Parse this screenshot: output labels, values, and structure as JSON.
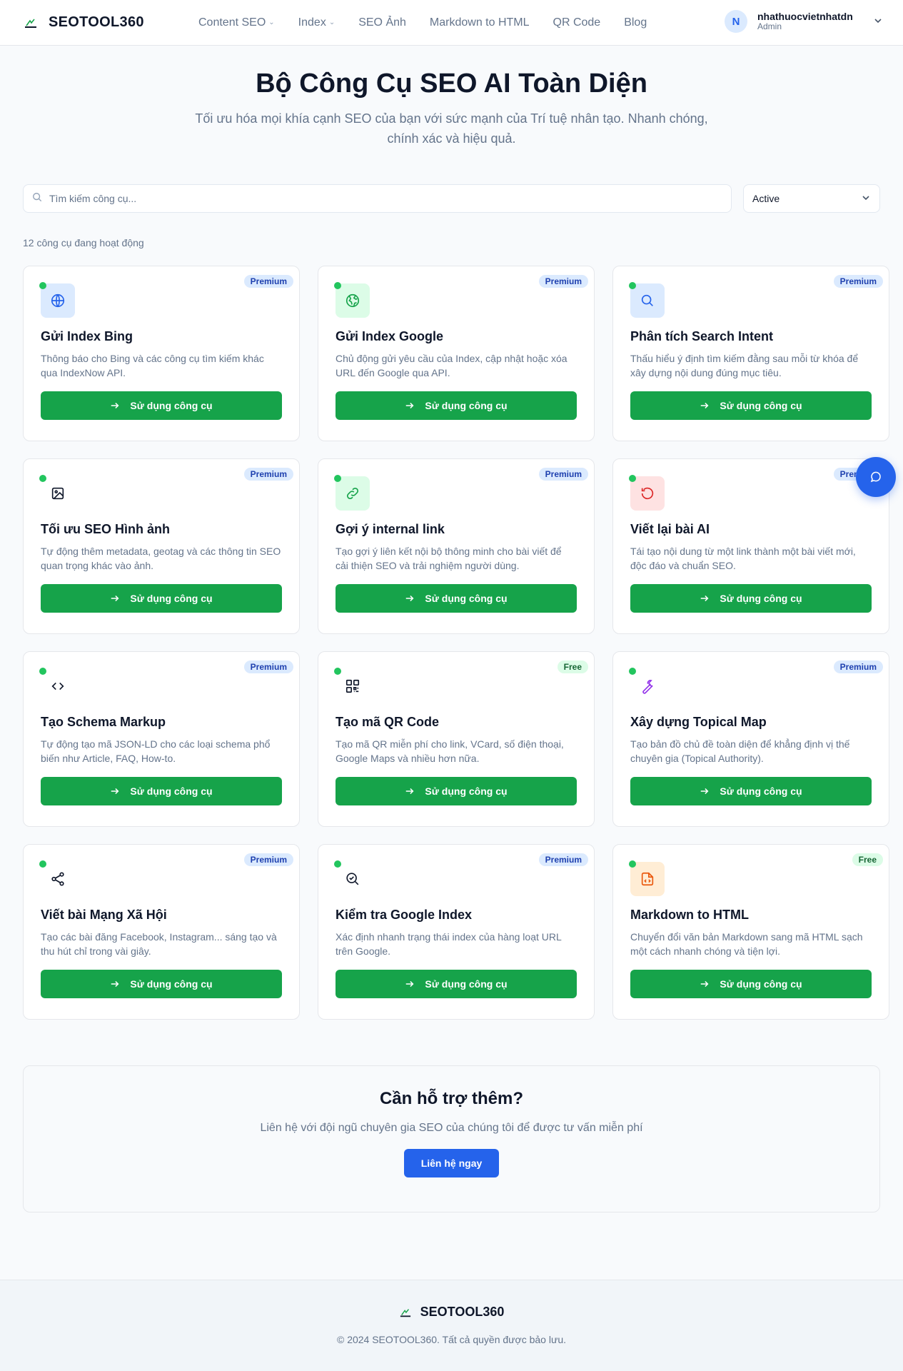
{
  "header": {
    "brand": "SEOTOOL360",
    "nav": [
      {
        "label": "Content SEO",
        "dropdown": true
      },
      {
        "label": "Index",
        "dropdown": true
      },
      {
        "label": "SEO Ảnh",
        "dropdown": false
      },
      {
        "label": "Markdown to HTML",
        "dropdown": false
      },
      {
        "label": "QR Code",
        "dropdown": false
      },
      {
        "label": "Blog",
        "dropdown": false
      }
    ],
    "user": {
      "initial": "N",
      "name": "nhathuocvietnhatdn",
      "role": "Admin"
    }
  },
  "hero": {
    "title": "Bộ Công Cụ SEO AI Toàn Diện",
    "subtitle": "Tối ưu hóa mọi khía cạnh SEO của bạn với sức mạnh của Trí tuệ nhân tạo. Nhanh chóng, chính xác và hiệu quả."
  },
  "filters": {
    "search_placeholder": "Tìm kiếm công cụ...",
    "status_value": "Active",
    "count_text": "12 công cụ đang hoạt động"
  },
  "tools": [
    {
      "title": "Gửi Index Bing",
      "desc": "Thông báo cho Bing và các công cụ tìm kiếm khác qua IndexNow API.",
      "badge": "Premium",
      "icon": "globe-icon"
    },
    {
      "title": "Gửi Index Google",
      "desc": "Chủ động gửi yêu cầu của Index, cập nhật hoặc xóa URL đến Google qua API.",
      "badge": "Premium",
      "icon": "earth-icon"
    },
    {
      "title": "Phân tích Search Intent",
      "desc": "Thấu hiểu ý định tìm kiếm đằng sau mỗi từ khóa để xây dựng nội dung đúng mục tiêu.",
      "badge": "Premium",
      "icon": "search-icon"
    },
    {
      "title": "Tối ưu SEO Hình ảnh",
      "desc": "Tự động thêm metadata, geotag và các thông tin SEO quan trọng khác vào ảnh.",
      "badge": "Premium",
      "icon": "image-icon"
    },
    {
      "title": "Gợi ý internal link",
      "desc": "Tạo gợi ý liên kết nội bộ thông minh cho bài viết để cải thiện SEO và trải nghiệm người dùng.",
      "badge": "Premium",
      "icon": "link-icon"
    },
    {
      "title": "Viết lại bài AI",
      "desc": "Tái tạo nội dung từ một link thành một bài viết mới, độc đáo và chuẩn SEO.",
      "badge": "Premium",
      "icon": "rotate-icon"
    },
    {
      "title": "Tạo Schema Markup",
      "desc": "Tự động tạo mã JSON-LD cho các loại schema phổ biến như Article, FAQ, How-to.",
      "badge": "Premium",
      "icon": "code-icon"
    },
    {
      "title": "Tạo mã QR Code",
      "desc": "Tạo mã QR miễn phí cho link, VCard, số điện thoại, Google Maps và nhiều hơn nữa.",
      "badge": "Free",
      "icon": "qr-code-icon"
    },
    {
      "title": "Xây dựng Topical Map",
      "desc": "Tạo bản đồ chủ đề toàn diện để khẳng định vị thế chuyên gia (Topical Authority).",
      "badge": "Premium",
      "icon": "wrench-icon"
    },
    {
      "title": "Viết bài Mạng Xã Hội",
      "desc": "Tạo các bài đăng Facebook, Instagram... sáng tạo và thu hút chỉ trong vài giây.",
      "badge": "Premium",
      "icon": "share-icon"
    },
    {
      "title": "Kiểm tra Google Index",
      "desc": "Xác định nhanh trạng thái index của hàng loạt URL trên Google.",
      "badge": "Premium",
      "icon": "search-check-icon"
    },
    {
      "title": "Markdown to HTML",
      "desc": "Chuyển đổi văn bản Markdown sang mã HTML sạch một cách nhanh chóng và tiện lợi.",
      "badge": "Free",
      "icon": "file-code-icon"
    }
  ],
  "tool_button_label": "Sử dụng công cụ",
  "support": {
    "title": "Cần hỗ trợ thêm?",
    "text": "Liên hệ với đội ngũ chuyên gia SEO của chúng tôi để được tư vấn miễn phí",
    "button": "Liên hệ ngay"
  },
  "footer": {
    "brand": "SEOTOOL360",
    "copyright": "© 2024 SEOTOOL360. Tất cả quyền được bảo lưu."
  },
  "colors": {
    "primary_green": "#16a34a",
    "primary_blue": "#2563eb",
    "active_dot": "#22c55e"
  }
}
